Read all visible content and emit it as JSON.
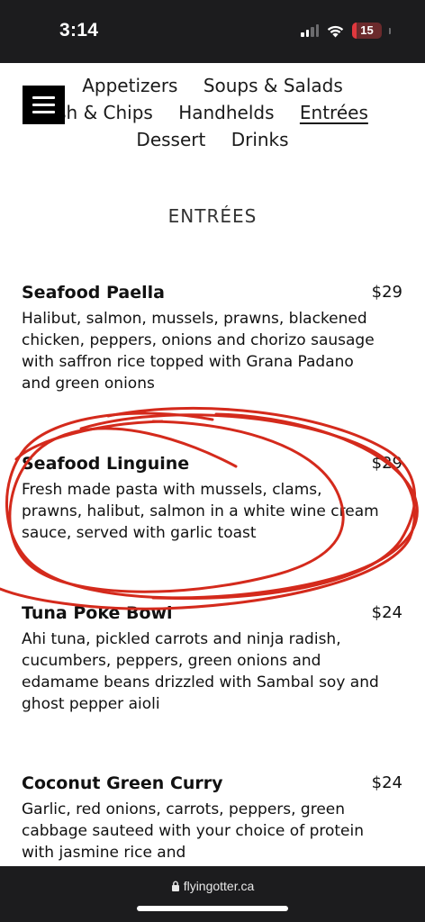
{
  "status_bar": {
    "time": "3:14",
    "battery": {
      "level": "15",
      "fill_fraction": 0.15,
      "color": "#e0383e"
    },
    "signal_bars_active": 2,
    "icons": [
      "cellular-signal-icon",
      "wifi-icon",
      "battery-icon"
    ]
  },
  "nav": {
    "menu_icon": "hamburger-menu-icon",
    "rows": [
      [
        "Appetizers",
        "Soups & Salads"
      ],
      [
        "sh & Chips",
        "Handhelds",
        "Entrées"
      ],
      [
        "Dessert",
        "Drinks"
      ]
    ],
    "active": "Entrées"
  },
  "section": {
    "title": "ENTRÉES"
  },
  "items": [
    {
      "name": "Seafood Paella",
      "price": "$29",
      "description": "Halibut, salmon, mussels, prawns, blackened chicken, peppers, onions and chorizo sausage with saffron rice topped with Grana Padano and green onions"
    },
    {
      "name": "Seafood Linguine",
      "price": "$29",
      "description": "Fresh made pasta with mussels, clams, prawns, halibut, salmon in a white wine cream sauce, served with garlic toast"
    },
    {
      "name": "Tuna Poke Bowl",
      "price": "$24",
      "description": "Ahi tuna, pickled carrots and ninja radish, cucumbers, peppers, green onions and edamame beans drizzled with Sambal soy and ghost pepper aioli"
    },
    {
      "name": "Coconut Green Curry",
      "price": "$24",
      "description": "Garlic, red onions, carrots, peppers, green cabbage sauteed with your choice of protein with jasmine rice and"
    }
  ],
  "annotation": {
    "color": "#d42a1c",
    "shape": "hand-drawn circle around Seafood Linguine"
  },
  "browser": {
    "url": "flyingotter.ca",
    "lock_icon": "lock-icon"
  }
}
